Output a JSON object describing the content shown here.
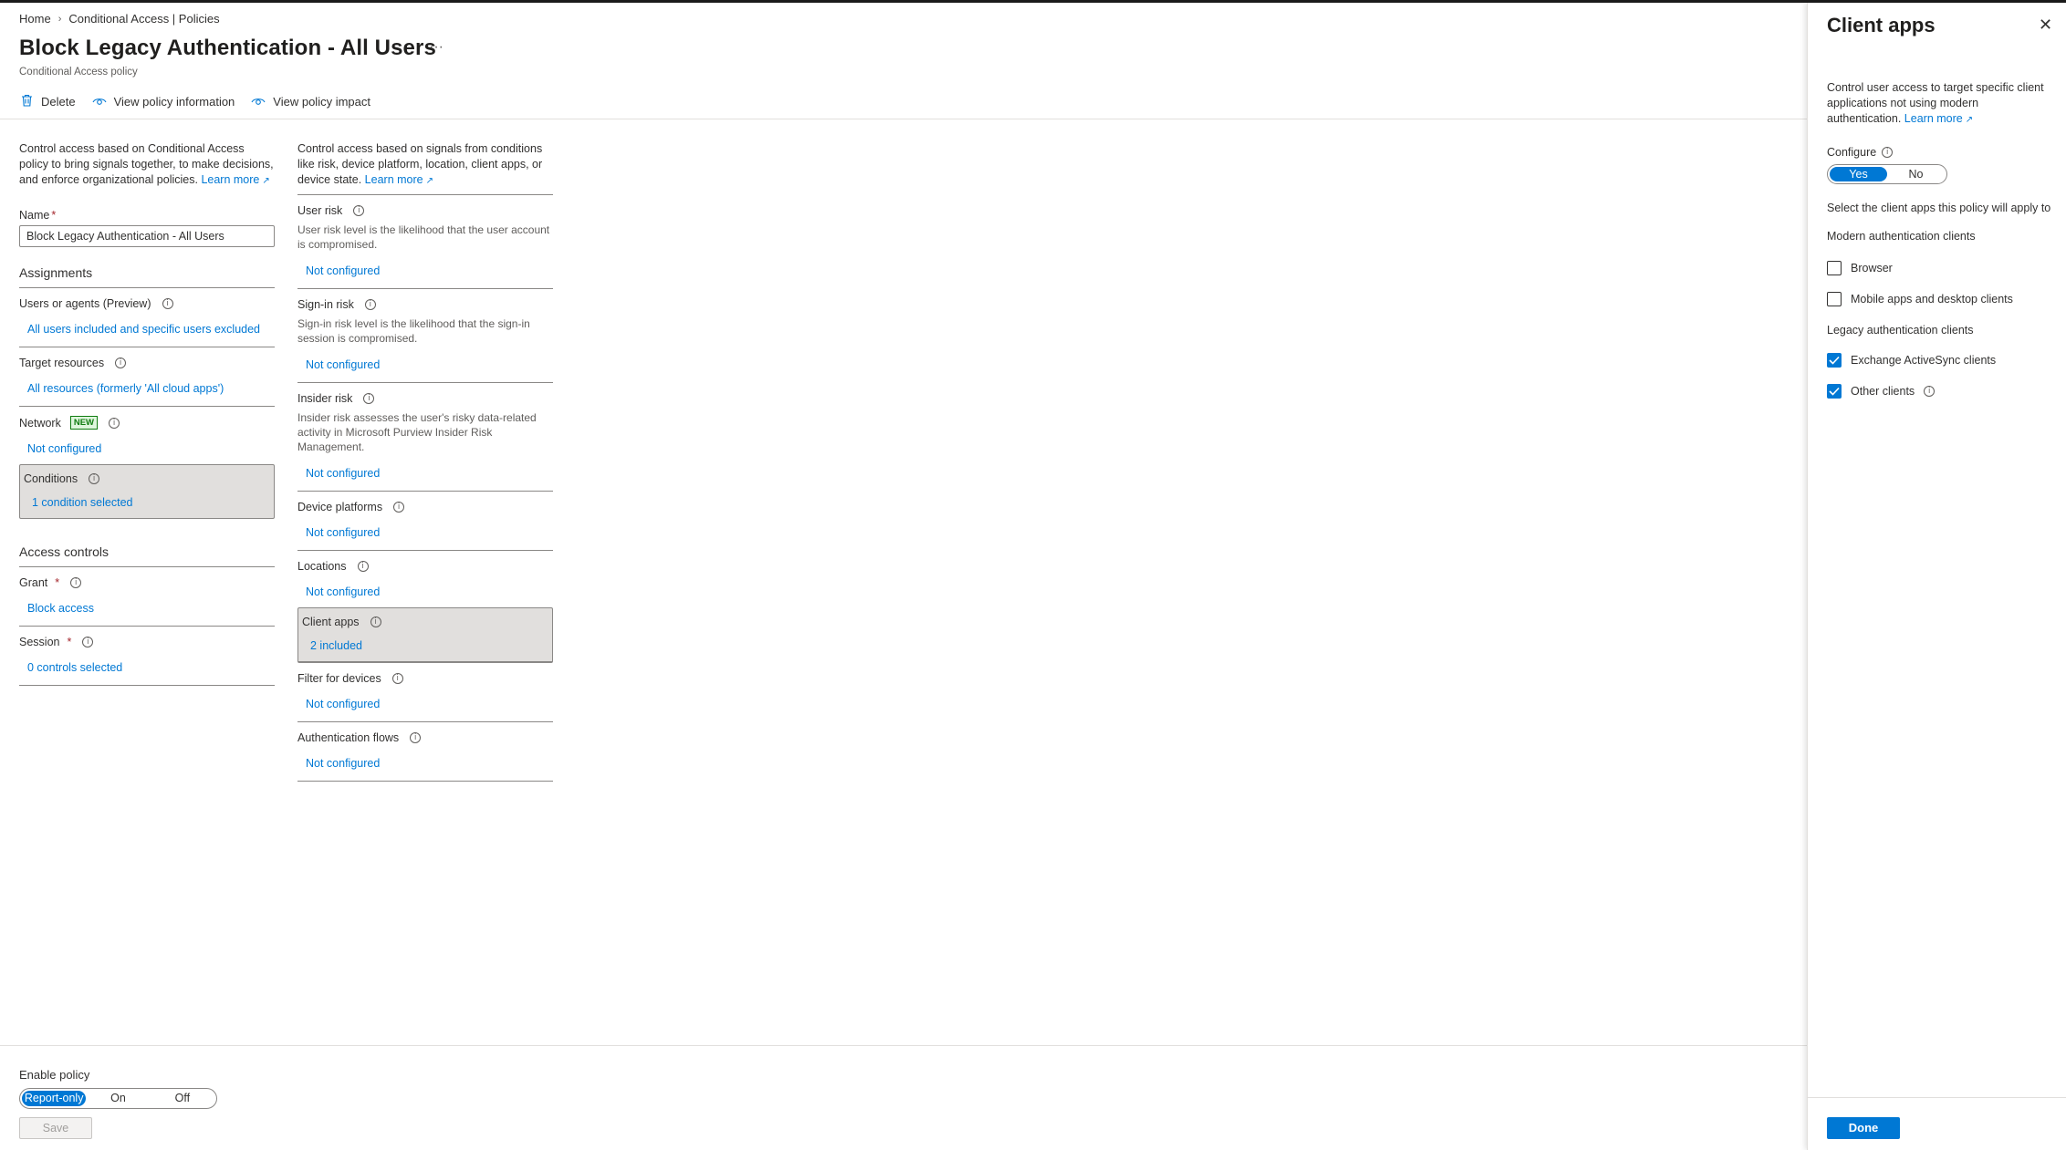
{
  "breadcrumb": {
    "home": "Home",
    "current": "Conditional Access | Policies",
    "separator": "›"
  },
  "header": {
    "title": "Block Legacy Authentication - All Users",
    "ellipsis": "···",
    "subtitle": "Conditional Access policy"
  },
  "toolbar": {
    "delete_label": "Delete",
    "view_info_label": "View policy information",
    "view_impact_label": "View policy impact"
  },
  "left": {
    "description": "Control access based on Conditional Access policy to bring signals together, to make decisions, and enforce organizational policies.",
    "learn_more": "Learn more",
    "name_label": "Name",
    "name_value": "Block Legacy Authentication - All Users",
    "assignments": "Assignments",
    "users_label": "Users or agents (Preview)",
    "users_value": "All users included and specific users excluded",
    "target_label": "Target resources",
    "target_value": "All resources (formerly 'All cloud apps')",
    "network_label": "Network",
    "network_badge": "NEW",
    "network_value": "Not configured",
    "conditions_label": "Conditions",
    "conditions_value": "1 condition selected",
    "access_controls": "Access controls",
    "grant_label": "Grant",
    "grant_value": "Block access",
    "session_label": "Session",
    "session_value": "0 controls selected"
  },
  "right": {
    "description": "Control access based on signals from conditions like risk, device platform, location, client apps, or device state.",
    "learn_more": "Learn more",
    "user_risk_label": "User risk",
    "user_risk_desc": "User risk level is the likelihood that the user account is compromised.",
    "user_risk_value": "Not configured",
    "signin_risk_label": "Sign-in risk",
    "signin_risk_desc": "Sign-in risk level is the likelihood that the sign-in session is compromised.",
    "signin_risk_value": "Not configured",
    "insider_risk_label": "Insider risk",
    "insider_risk_desc": "Insider risk assesses the user's risky data-related activity in Microsoft Purview Insider Risk Management.",
    "insider_risk_value": "Not configured",
    "device_platforms_label": "Device platforms",
    "device_platforms_value": "Not configured",
    "locations_label": "Locations",
    "locations_value": "Not configured",
    "client_apps_label": "Client apps",
    "client_apps_value": "2 included",
    "filter_devices_label": "Filter for devices",
    "filter_devices_value": "Not configured",
    "auth_flows_label": "Authentication flows",
    "auth_flows_value": "Not configured"
  },
  "footer": {
    "enable_label": "Enable policy",
    "options": [
      "Report-only",
      "On",
      "Off"
    ],
    "selected": "Report-only",
    "save_label": "Save"
  },
  "panel": {
    "title": "Client apps",
    "close_glyph": "✕",
    "description": "Control user access to target specific client applications not using modern authentication.",
    "learn_more": "Learn more",
    "configure_label": "Configure",
    "configure_yes": "Yes",
    "configure_no": "No",
    "configure_selected": "Yes",
    "select_text": "Select the client apps this policy will apply to",
    "modern_heading": "Modern authentication clients",
    "browser_label": "Browser",
    "browser_checked": false,
    "mobile_label": "Mobile apps and desktop clients",
    "mobile_checked": false,
    "legacy_heading": "Legacy authentication clients",
    "exchange_label": "Exchange ActiveSync clients",
    "exchange_checked": true,
    "other_label": "Other clients",
    "other_checked": true,
    "done_label": "Done"
  },
  "colors": {
    "accent": "#0078d4",
    "text": "#323130",
    "selected_bg": "#e1dfdd",
    "new_badge": "#107c10"
  },
  "icons": {
    "delete": "trash-icon",
    "view_info": "eye-icon",
    "view_impact": "eye-icon",
    "info": "info-icon",
    "external": "external-link-icon",
    "check": "checkmark-icon",
    "close": "close-icon"
  }
}
